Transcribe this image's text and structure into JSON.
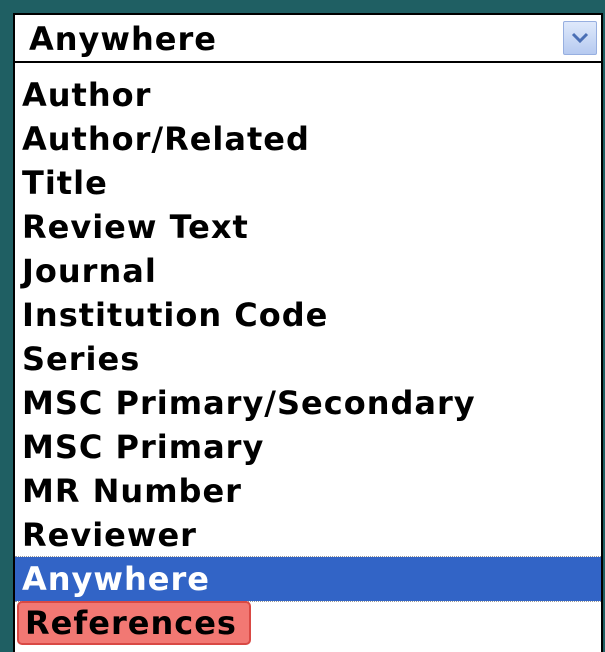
{
  "select": {
    "value": "Anywhere",
    "arrow_icon": "chevron-down-icon"
  },
  "options": [
    {
      "label": "Author"
    },
    {
      "label": "Author/Related"
    },
    {
      "label": "Title"
    },
    {
      "label": "Review Text"
    },
    {
      "label": "Journal"
    },
    {
      "label": "Institution Code"
    },
    {
      "label": "Series"
    },
    {
      "label": "MSC Primary/Secondary"
    },
    {
      "label": "MSC Primary"
    },
    {
      "label": "MR Number"
    },
    {
      "label": "Reviewer"
    },
    {
      "label": "Anywhere"
    },
    {
      "label": "References"
    }
  ],
  "selected_index": 11,
  "highlighted_index": 12,
  "colors": {
    "background": "#1f5f63",
    "selected_bg": "#3264c6",
    "highlight_bg": "#f27873"
  }
}
